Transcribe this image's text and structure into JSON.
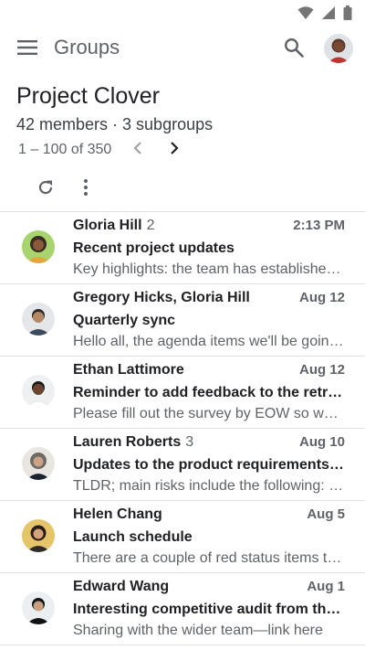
{
  "app": {
    "title": "Groups"
  },
  "group": {
    "name": "Project Clover",
    "meta": "42 members · 3 subgroups"
  },
  "pagination": {
    "range": "1 – 100 of 350"
  },
  "icons": {
    "status": [
      "wifi-icon",
      "signal-icon",
      "battery-icon"
    ],
    "header": [
      "menu-icon",
      "search-icon"
    ],
    "toolbar": [
      "refresh-icon",
      "more-vert-icon"
    ],
    "nav": [
      "chevron-left-icon",
      "chevron-right-icon"
    ]
  },
  "colors": {
    "text_primary": "#202124",
    "text_secondary": "#5f6368",
    "divider": "#e0e0e0"
  },
  "conversations": [
    {
      "sender": "Gloria Hill",
      "count": "2",
      "time": "2:13 PM",
      "subject": "Recent project updates",
      "snippet": "Key highlights: the team has established…"
    },
    {
      "sender": "Gregory Hicks, Gloria Hill",
      "count": "",
      "time": "Aug 12",
      "subject": "Quarterly sync",
      "snippet": "Hello all, the agenda items we'll be going…"
    },
    {
      "sender": "Ethan Lattimore",
      "count": "",
      "time": "Aug 12",
      "subject": "Reminder to add feedback to the retrosp…",
      "snippet": "Please fill out the survey by EOW so we c…"
    },
    {
      "sender": "Lauren Roberts",
      "count": "3",
      "time": "Aug 10",
      "subject": "Updates to the product requirements doc",
      "snippet": "TLDR; main risks include the following: …"
    },
    {
      "sender": "Helen Chang",
      "count": "",
      "time": "Aug 5",
      "subject": "Launch schedule",
      "snippet": "There are a couple of red status items th…"
    },
    {
      "sender": "Edward Wang",
      "count": "",
      "time": "Aug 1",
      "subject": "Interesting competitive audit from the s…",
      "snippet": "Sharing with the wider team—link here"
    }
  ]
}
